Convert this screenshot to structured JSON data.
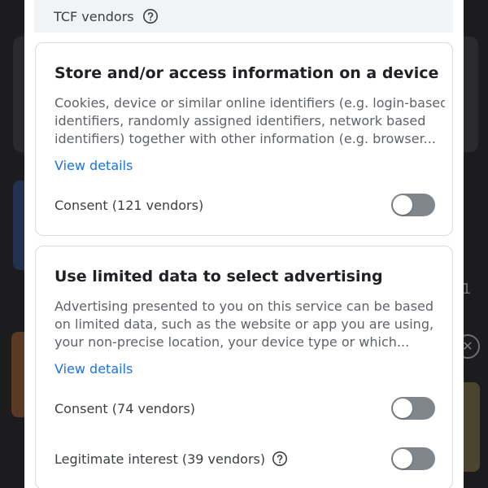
{
  "background": {
    "digit": "1",
    "close_glyph": "✕"
  },
  "tcf": {
    "label": "TCF vendors",
    "icon": "help-circle-icon"
  },
  "purposes": [
    {
      "title": "Store and/or access information on a device",
      "description_lines": [
        "Cookies, device or similar online identifiers (e.g. login-based",
        "identifiers, randomly assigned identifiers, network based",
        "identifiers) together with other information (e.g. browser..."
      ],
      "link": "View details",
      "toggles": [
        {
          "label": "Consent (121 vendors)",
          "state": "off",
          "has_help_icon": false
        }
      ]
    },
    {
      "title": "Use limited data to select advertising",
      "description_lines": [
        "Advertising presented to you on this service can be based",
        "on limited data, such as the website or app you are using,",
        "your non-precise location, your device type or which..."
      ],
      "link": "View details",
      "toggles": [
        {
          "label": "Consent (74 vendors)",
          "state": "off",
          "has_help_icon": false
        },
        {
          "label": "Legitimate interest (39 vendors)",
          "state": "off",
          "has_help_icon": true
        }
      ]
    }
  ],
  "colors": {
    "link": "#1a73e8",
    "toggle_off_track": "#80868b",
    "card_border": "#dadce0",
    "header_bar": "#f1f3f4"
  }
}
